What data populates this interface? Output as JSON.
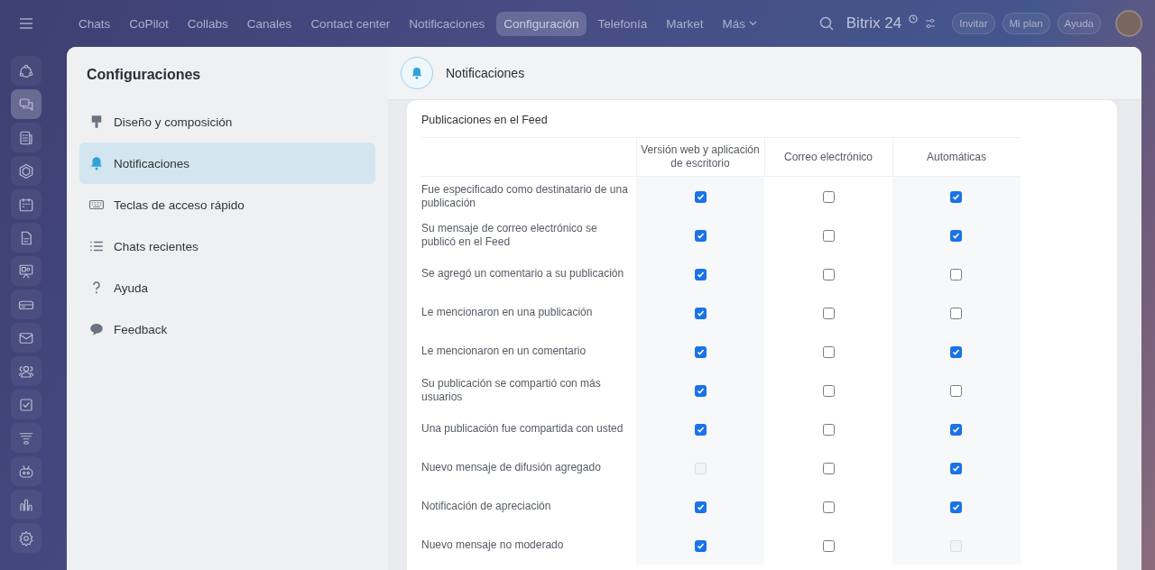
{
  "top_nav": {
    "tabs": [
      {
        "label": "Chats",
        "selected": false
      },
      {
        "label": "CoPilot",
        "selected": false
      },
      {
        "label": "Collabs",
        "selected": false
      },
      {
        "label": "Canales",
        "selected": false
      },
      {
        "label": "Contact center",
        "selected": false
      },
      {
        "label": "Notificaciones",
        "selected": false
      },
      {
        "label": "Configuración",
        "selected": true
      },
      {
        "label": "Telefonía",
        "selected": false
      },
      {
        "label": "Market",
        "selected": false
      },
      {
        "label": "Más",
        "selected": false
      }
    ],
    "logo": "Bitrix 24",
    "buttons": [
      "Invitar",
      "Mi plan",
      "Ayuda"
    ]
  },
  "rail": [
    {
      "selected": false
    },
    {
      "selected": true
    },
    {
      "selected": false
    },
    {
      "selected": false
    },
    {
      "selected": false
    },
    {
      "selected": false
    },
    {
      "selected": false
    },
    {
      "selected": false
    },
    {
      "selected": false
    },
    {
      "selected": false
    },
    {
      "selected": false
    },
    {
      "selected": false
    },
    {
      "selected": false
    },
    {
      "selected": false
    },
    {
      "selected": false
    }
  ],
  "sidebar": {
    "title": "Configuraciones",
    "items": [
      {
        "label": "Diseño y composición",
        "selected": false
      },
      {
        "label": "Notificaciones",
        "selected": true
      },
      {
        "label": "Teclas de acceso rápido",
        "selected": false
      },
      {
        "label": "Chats recientes",
        "selected": false
      },
      {
        "label": "Ayuda",
        "selected": false
      },
      {
        "label": "Feedback",
        "selected": false
      }
    ]
  },
  "header": {
    "title": "Notificaciones"
  },
  "section": {
    "title": "Publicaciones en el Feed",
    "columns": [
      "Versión web y aplicación de escritorio",
      "Correo electrónico",
      "Automáticas"
    ],
    "rows": [
      {
        "label": "Fue especificado como destinatario de una publicación",
        "cells": [
          {
            "checked": true,
            "disabled": false
          },
          {
            "checked": false,
            "disabled": false
          },
          {
            "checked": true,
            "disabled": false
          }
        ]
      },
      {
        "label": "Su mensaje de correo electrónico se publicó en el Feed",
        "cells": [
          {
            "checked": true,
            "disabled": false
          },
          {
            "checked": false,
            "disabled": false
          },
          {
            "checked": true,
            "disabled": false
          }
        ]
      },
      {
        "label": "Se agregó un comentario a su publicación",
        "cells": [
          {
            "checked": true,
            "disabled": false
          },
          {
            "checked": false,
            "disabled": false
          },
          {
            "checked": false,
            "disabled": false
          }
        ]
      },
      {
        "label": "Le mencionaron en una publicación",
        "cells": [
          {
            "checked": true,
            "disabled": false
          },
          {
            "checked": false,
            "disabled": false
          },
          {
            "checked": false,
            "disabled": false
          }
        ]
      },
      {
        "label": "Le mencionaron en un comentario",
        "cells": [
          {
            "checked": true,
            "disabled": false
          },
          {
            "checked": false,
            "disabled": false
          },
          {
            "checked": true,
            "disabled": false
          }
        ]
      },
      {
        "label": "Su publicación se compartió con más usuarios",
        "cells": [
          {
            "checked": true,
            "disabled": false
          },
          {
            "checked": false,
            "disabled": false
          },
          {
            "checked": false,
            "disabled": false
          }
        ]
      },
      {
        "label": "Una publicación fue compartida con usted",
        "cells": [
          {
            "checked": true,
            "disabled": false
          },
          {
            "checked": false,
            "disabled": false
          },
          {
            "checked": true,
            "disabled": false
          }
        ]
      },
      {
        "label": "Nuevo mensaje de difusión agregado",
        "cells": [
          {
            "checked": false,
            "disabled": true
          },
          {
            "checked": false,
            "disabled": false
          },
          {
            "checked": true,
            "disabled": false
          }
        ]
      },
      {
        "label": "Notificación de apreciación",
        "cells": [
          {
            "checked": true,
            "disabled": false
          },
          {
            "checked": false,
            "disabled": false
          },
          {
            "checked": true,
            "disabled": false
          }
        ]
      },
      {
        "label": "Nuevo mensaje no moderado",
        "cells": [
          {
            "checked": true,
            "disabled": false
          },
          {
            "checked": false,
            "disabled": false
          },
          {
            "checked": false,
            "disabled": true
          }
        ]
      }
    ]
  }
}
